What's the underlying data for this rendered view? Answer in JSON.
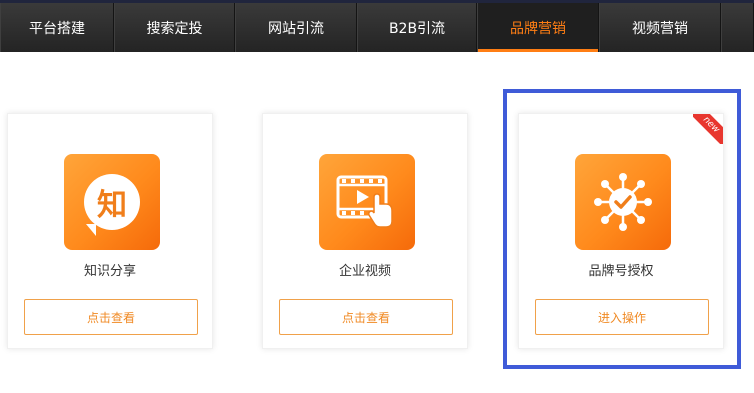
{
  "nav": {
    "tabs": [
      {
        "label": "平台搭建"
      },
      {
        "label": "搜索定投"
      },
      {
        "label": "网站引流"
      },
      {
        "label": "B2B引流"
      },
      {
        "label": "品牌营销",
        "active": true
      },
      {
        "label": "视频营销"
      }
    ]
  },
  "cards": [
    {
      "title": "知识分享",
      "icon": "knowledge-icon",
      "icon_text": "知",
      "button": "点击查看"
    },
    {
      "title": "企业视频",
      "icon": "video-play-icon",
      "button": "点击查看"
    },
    {
      "title": "品牌号授权",
      "icon": "network-check-icon",
      "button": "进入操作",
      "badge": "new"
    }
  ],
  "colors": {
    "accent": "#ff7e14",
    "highlight_border": "#3f5bd8",
    "badge": "#e8362e",
    "nav_bg": "#2b2b2b"
  }
}
